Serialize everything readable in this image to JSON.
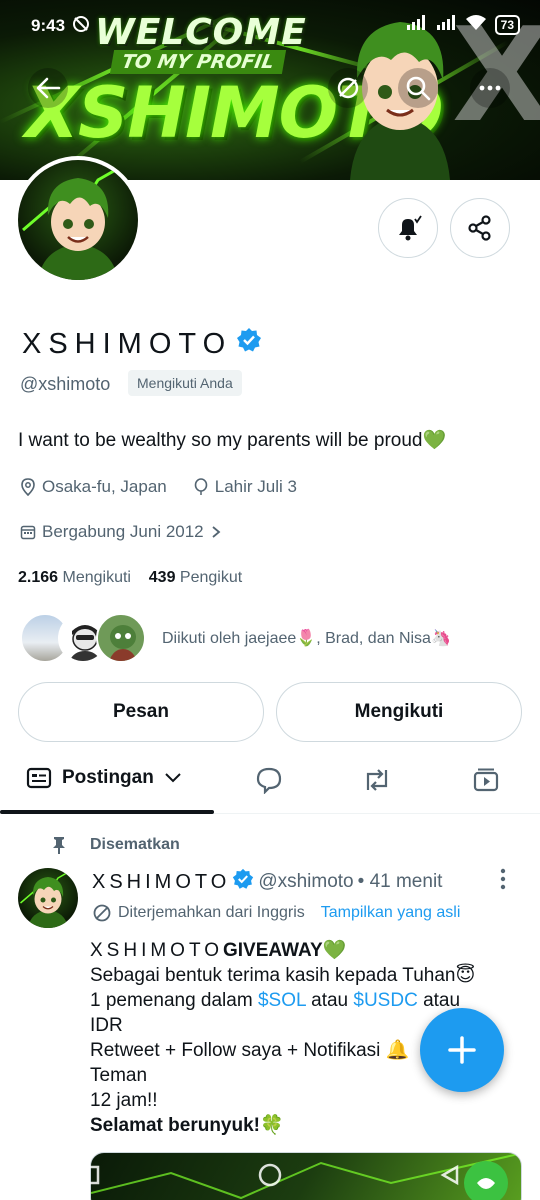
{
  "status_bar": {
    "time": "9:43",
    "battery": "73"
  },
  "banner": {
    "welcome": "WELCOME",
    "subtitle": "TO MY PROFIL",
    "name": "XSHIMOTO"
  },
  "profile": {
    "display_name": "XSHIMOTO",
    "handle": "@xshimoto",
    "follows_you_badge": "Mengikuti Anda",
    "bio": "I want to be wealthy so my parents will be proud💚",
    "location": "Osaka-fu, Japan",
    "birthday": "Lahir Juli 3",
    "joined": "Bergabung Juni 2012",
    "following_count": "2.166",
    "following_label": "Mengikuti",
    "followers_count": "439",
    "followers_label": "Pengikut",
    "followed_by": "Diikuti oleh jaejaee🌷, Brad, dan Nisa🦄"
  },
  "actions": {
    "message": "Pesan",
    "following": "Mengikuti"
  },
  "tabs": {
    "active": "Postingan"
  },
  "pinned_tweet": {
    "pinned_label": "Disematkan",
    "author_name": "XSHIMOTO",
    "author_handle": "@xshimoto",
    "age": "• 41 menit",
    "translated_label": "Diterjemahkan dari Inggris",
    "show_original": "Tampilkan yang asli",
    "line1_name": "XSHIMOTO",
    "line1_rest": "GIVEAWAY💚",
    "line2": "Sebagai bentuk terima kasih kepada Tuhan😇",
    "line3_pre": "1 pemenang dalam ",
    "cash1": "$SOL",
    "line3_mid": " atau ",
    "cash2": "$USDC",
    "line3_post": " atau",
    "line4": "IDR",
    "line5": "Retweet + Follow saya + Notifikasi 🔔",
    "line6": "Teman",
    "line7": "12 jam!!",
    "line8": "Selamat berunyuk!🍀"
  },
  "colors": {
    "accent": "#1d9bf0",
    "text": "#0f1419",
    "muted": "#536471",
    "border": "#cfd9de"
  }
}
